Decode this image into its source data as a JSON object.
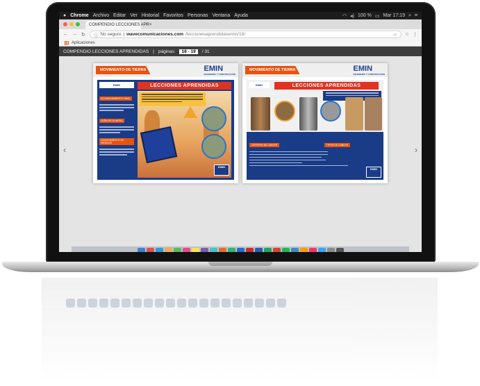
{
  "menubar": {
    "app_name": "Chrome",
    "items": [
      "Archivo",
      "Editar",
      "Ver",
      "Historial",
      "Favoritos",
      "Personas",
      "Ventana",
      "Ayuda"
    ],
    "battery": "100 %",
    "datetime": "Mar 17:19"
  },
  "browser": {
    "tab_title": "COMPENDIO LECCIONES APR",
    "security_label": "No seguro",
    "url_domain": "wavecomunicaciones.com",
    "url_path": "/leccionesaprendidasemin/18/",
    "bookmarks_label": "Aplicaciones"
  },
  "viewer": {
    "doc_title": "COMPENDIO LECCIONES APRENDIDAS",
    "pages_label": "páginas:",
    "current_pages": "18 - 19",
    "total_pages": "/ 31",
    "left_page": {
      "tag": "MOVIMIENTO DE TIERRA",
      "logo": "EMIN",
      "logo_sub": "INGENIERÍA Y CONSTRUCCIÓN",
      "title": "LECCIONES APRENDIDAS",
      "sidebar_logo": "EMIN",
      "sections": [
        "ACOMODAMIENTO FINAL",
        "CUÑA DE GUARDA",
        "CONOCIMIENTO DE RIESGOS"
      ],
      "stamp": "EMIN"
    },
    "right_page": {
      "tag": "MOVIMIENTO DE TIERRA",
      "logo": "EMIN",
      "logo_sub": "INGENIERÍA Y CONSTRUCCIÓN",
      "title": "LECCIONES APRENDIDAS",
      "sidebar_logo": "EMIN",
      "sections": [
        "CRITERIO DE CABLES",
        "TIPOS DE CABLES"
      ],
      "stamp": "EMIN"
    }
  },
  "colors": {
    "accent_orange": "#e8530f",
    "brand_blue": "#1a3b86",
    "title_red": "#e03321"
  }
}
